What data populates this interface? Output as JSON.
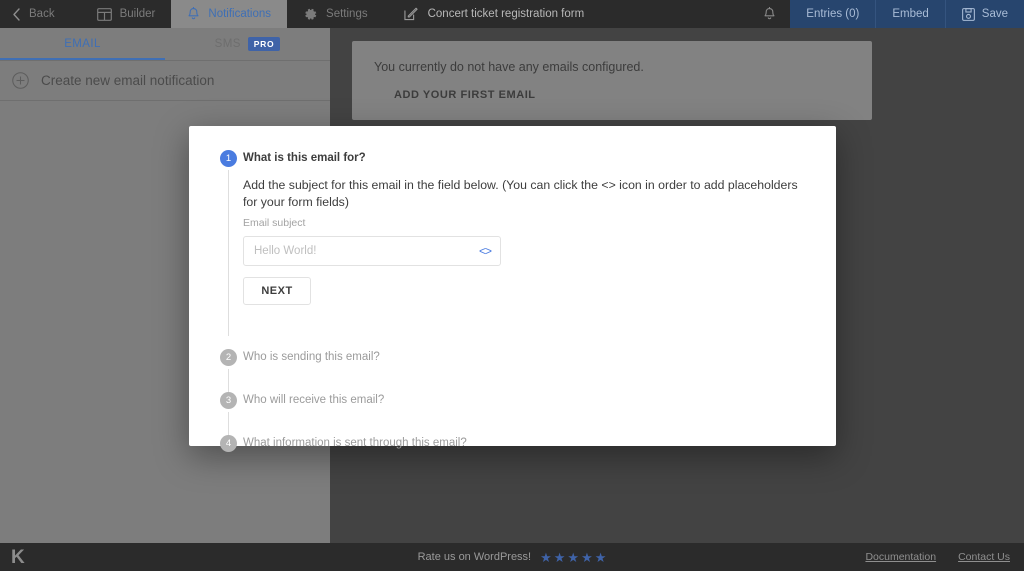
{
  "topbar": {
    "back_label": "Back",
    "nav": [
      {
        "label": "Builder",
        "icon": "builder-icon"
      },
      {
        "label": "Notifications",
        "icon": "bell-icon"
      },
      {
        "label": "Settings",
        "icon": "gear-icon"
      }
    ],
    "form_title": "Concert ticket registration form",
    "form_title_icon": "edit-pencil-icon",
    "notification_bell_icon": "bell-icon",
    "actions": [
      {
        "label": "Entries (0)"
      },
      {
        "label": "Embed"
      },
      {
        "label": "Save",
        "icon": "save-disk-icon"
      }
    ],
    "accent_blue": "#3f6fb5",
    "actions_bg": "#27456e"
  },
  "sidebar": {
    "tabs": [
      {
        "label": "EMAIL",
        "active": true
      },
      {
        "label": "SMS",
        "active": false,
        "badge": "PRO"
      }
    ],
    "create_label": "Create new email notification",
    "create_icon": "plus-circle-icon"
  },
  "main": {
    "empty_message": "You currently do not have any emails configured.",
    "add_first_label": "ADD YOUR FIRST EMAIL"
  },
  "modal": {
    "steps": [
      {
        "number": "1",
        "title": "What is this email for?",
        "active": true,
        "description": "Add the subject for this email in the field below. (You can click the <> icon in order to add placeholders for your form fields)",
        "field_label": "Email subject",
        "input_value": "",
        "input_placeholder": "Hello World!",
        "code_icon": "<>",
        "next_label": "NEXT"
      },
      {
        "number": "2",
        "title": "Who is sending this email?",
        "active": false
      },
      {
        "number": "3",
        "title": "Who will receive this email?",
        "active": false
      },
      {
        "number": "4",
        "title": "What information is sent through this email?",
        "active": false
      }
    ]
  },
  "footer": {
    "logo": "K",
    "rate_text": "Rate us on WordPress!",
    "stars": 5,
    "links": [
      {
        "label": "Documentation"
      },
      {
        "label": "Contact Us"
      }
    ]
  }
}
